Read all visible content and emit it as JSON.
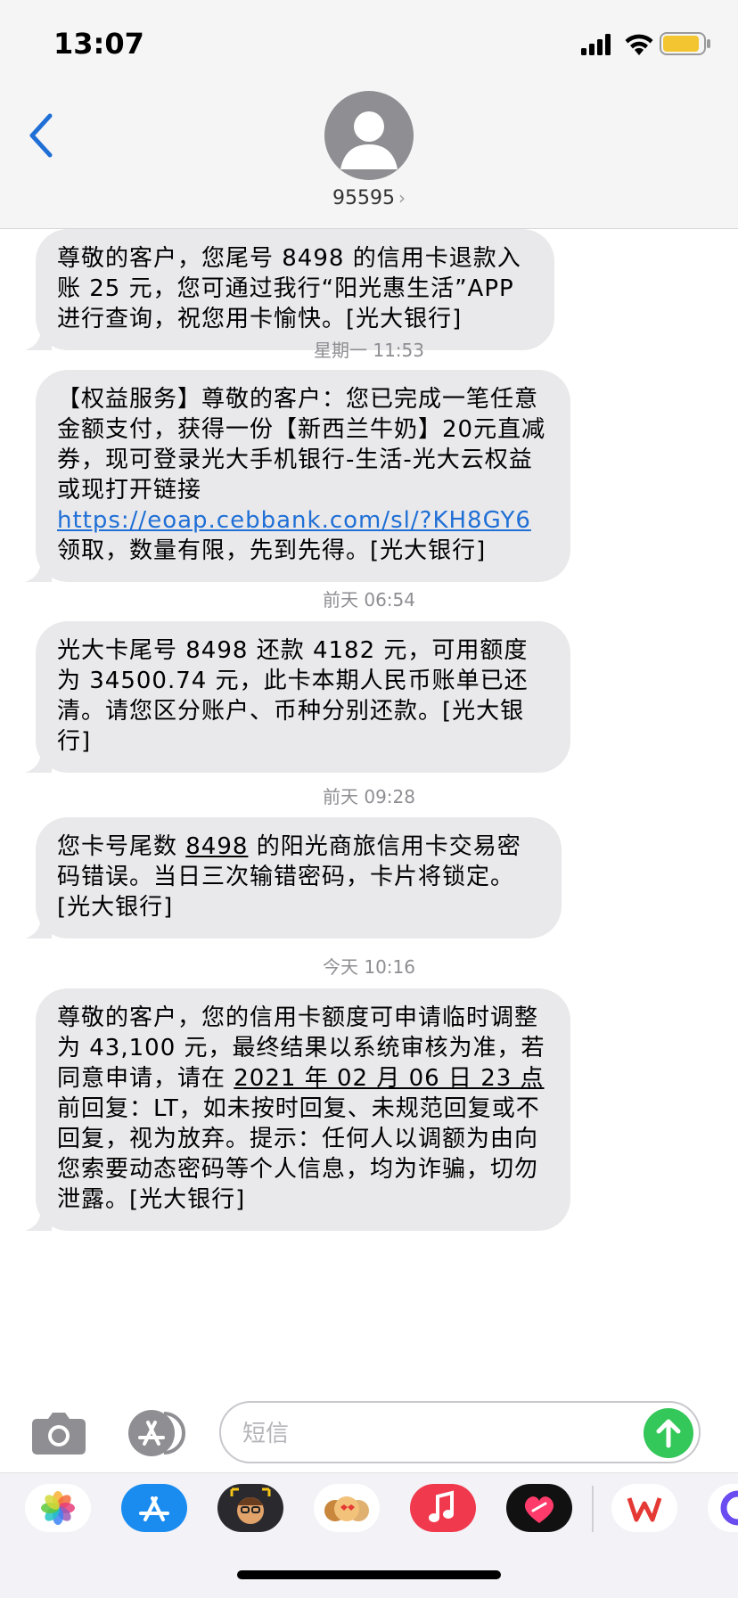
{
  "status_bar": {
    "time": "13:07"
  },
  "header": {
    "contact": "95595",
    "chevron": "›"
  },
  "conversation": [
    {
      "type": "message",
      "parts": [
        "尊敬的客户，您尾号 8498 的信用卡退款入账 25 元，您可通过我行“阳光惠生活”APP进行查询，祝您用卡愉快。[光大银行]"
      ]
    },
    {
      "type": "timestamp",
      "text": "星期一 11:53"
    },
    {
      "type": "message",
      "before_link": "【权益服务】尊敬的客户：您已完成一笔任意金额支付，获得一份【新西兰牛奶】20元直减券，现可登录光大手机银行-生活-光大云权益或现打开链接 ",
      "link": "https://eoap.cebbank.com/sl/?KH8GY6",
      "after_link": " 领取，数量有限，先到先得。[光大银行]"
    },
    {
      "type": "timestamp",
      "text": "前天 06:54"
    },
    {
      "type": "message",
      "text": "光大卡尾号 8498 还款 4182 元，可用额度为 34500.74 元，此卡本期人民币账单已还清。请您区分账户、币种分别还款。[光大银行]"
    },
    {
      "type": "timestamp",
      "text": "前天 09:28"
    },
    {
      "type": "message",
      "before": "您卡号尾数 ",
      "underlined": "8498",
      "after": " 的阳光商旅信用卡交易密码错误。当日三次输错密码，卡片将锁定。[光大银行]"
    },
    {
      "type": "timestamp",
      "text": "今天 10:16"
    },
    {
      "type": "message",
      "before": "尊敬的客户，您的信用卡额度可申请临时调整为 43,100 元，最终结果以系统审核为准，若同意申请，请在 ",
      "underlined": "2021 年 02 月 06 日 23 点",
      "after": "前回复：LT，如未按时回复、未规范回复或不回复，视为放弃。提示：任何人以调额为由向您索要动态密码等个人信息，均为诈骗，切勿泄露。[光大银行]"
    }
  ],
  "composer": {
    "placeholder": "短信"
  },
  "colors": {
    "accent": "#1f6fd6",
    "send": "#34c759",
    "bubble": "#e9e9eb"
  },
  "drawer_apps": [
    "photos-icon",
    "app-store-icon",
    "memoji-icon",
    "animoji-icon",
    "music-icon",
    "digital-touch-icon",
    "wps-icon",
    "partial-app-icon"
  ]
}
